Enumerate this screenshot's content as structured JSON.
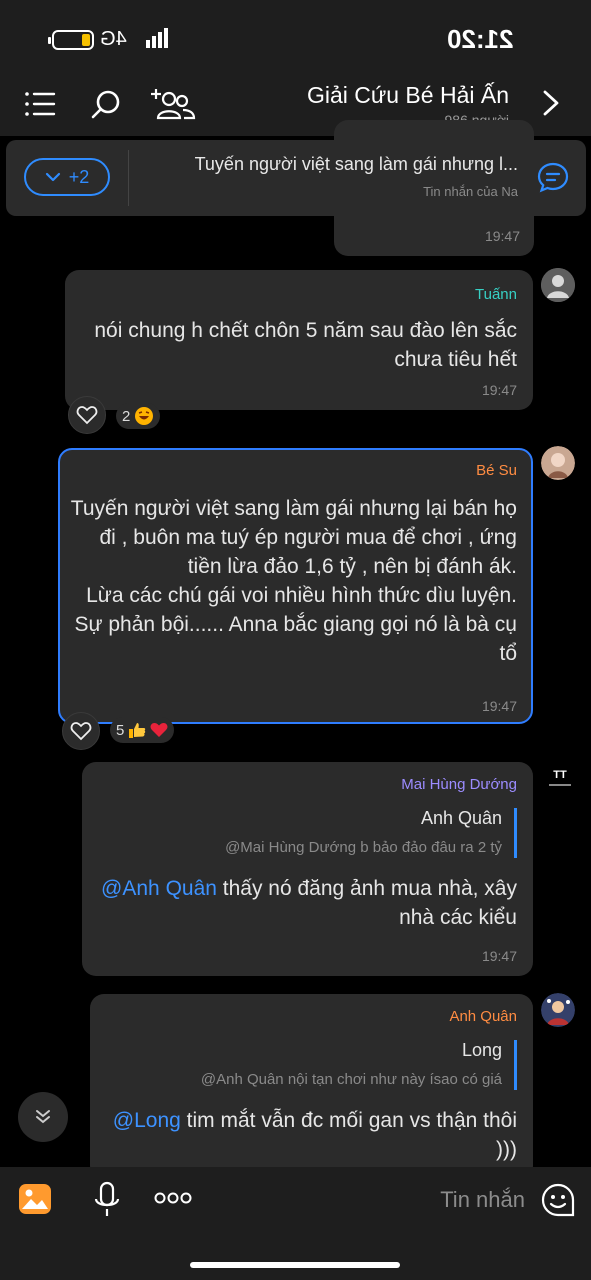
{
  "status": {
    "time": "21:20",
    "network": "4G"
  },
  "header": {
    "title": "Giải Cứu Bé Hải Ấn",
    "subtitle": "986 người"
  },
  "pinned": {
    "text": "Tuyến  người việt sang làm gái nhưng l...",
    "sub": "Tin nhắn của Na",
    "more": "+2"
  },
  "topbubble": {
    "time": "19:47"
  },
  "messages": [
    {
      "sender": "Tuấnn",
      "text": "nói chung h chết chôn 5 năm sau đào lên sắc chưa tiêu hết",
      "time": "19:47",
      "react_count": "2"
    },
    {
      "sender": "Bé Su",
      "text": "Tuyến  người việt sang làm gái nhưng lại bán họ đi , buôn ma tuý ép người mua để chơi , ứng tiền lừa đảo 1,6 tỷ , nên bị đánh ák.\nLừa các chú gái voi nhiều hình thức dìu luyện. Sự phản bội...... Anna bắc giang gọi nó là bà cụ tổ",
      "time": "19:47",
      "react_count": "5"
    },
    {
      "sender": "Mai Hùng Dướng",
      "quote_name": "Anh Quân",
      "quote_text": "@Mai Hùng Dướng b bảo đảo đâu ra 2 tỷ",
      "mention": "@Anh Quân",
      "text_after_mention": " thấy nó đăng ảnh mua nhà, xây nhà các kiểu",
      "time": "19:47"
    },
    {
      "sender": "Anh Quân",
      "quote_name": "Long",
      "quote_text": "@Anh Quân nội tạn chơi như này ísao có giá",
      "mention": "@Long",
      "text_after_mention": " tim mắt vẫn đc mối gan vs thận thôi )))"
    }
  ],
  "composer": {
    "placeholder": "Tin nhắn",
    "more": "ooo"
  },
  "colors": {
    "accent": "#2f8cff",
    "bubble": "#2b2b2b",
    "bar": "#1e1e1e"
  }
}
